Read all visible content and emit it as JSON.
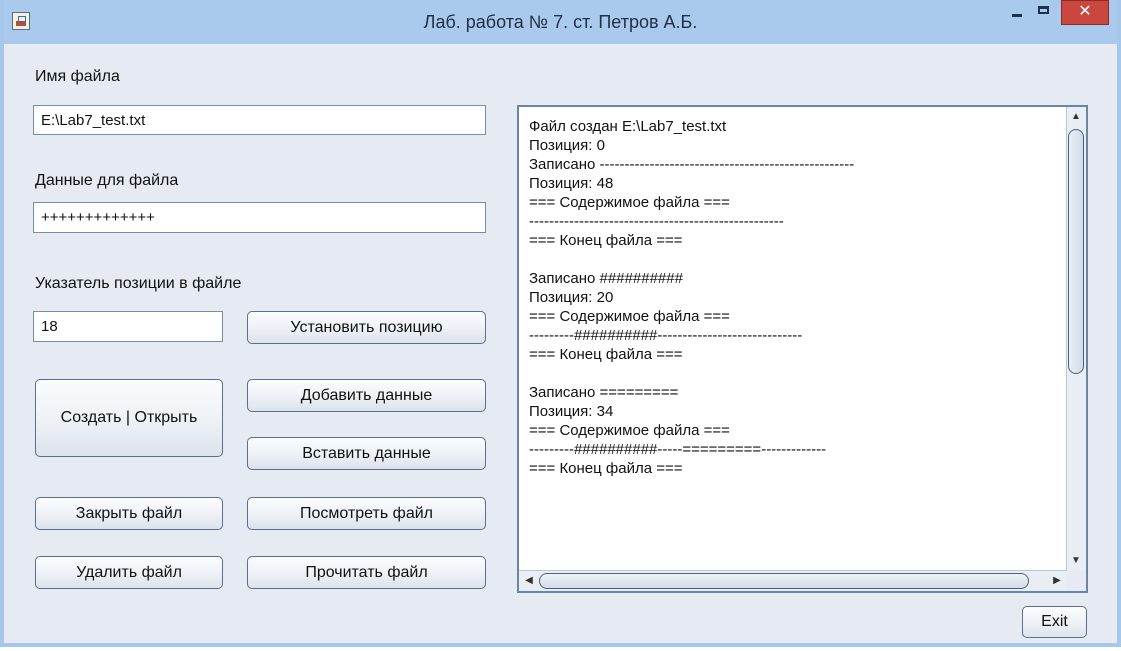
{
  "window": {
    "title": "Лаб. работа № 7. ст. Петров А.Б.",
    "close_symbol": "✕"
  },
  "form": {
    "filename_label": "Имя файла",
    "filename_value": "E:\\Lab7_test.txt",
    "data_label": "Данные для файла",
    "data_value": "+++++++++++++",
    "position_label": "Указатель позиции в файле",
    "position_value": "18"
  },
  "buttons": {
    "set_position": "Установить позицию",
    "create_open": "Создать | Открыть",
    "add_data": "Добавить данные",
    "insert_data": "Вставить данные",
    "close_file": "Закрыть файл",
    "view_file": "Посмотреть файл",
    "delete_file": "Удалить файл",
    "read_file": "Прочитать файл",
    "exit": "Exit"
  },
  "log": {
    "lines": [
      "Файл создан E:\\Lab7_test.txt",
      "Позиция: 0",
      "Записано ---------------------------------------------------",
      "Позиция: 48",
      "=== Содержимое файла ===",
      "---------------------------------------------------",
      "=== Конец файла ===",
      "",
      "Записано ##########",
      "Позиция: 20",
      "=== Содержимое файла ===",
      "---------##########-----------------------------",
      "=== Конец файла ===",
      "",
      "Записано =========",
      "Позиция: 34",
      "=== Содержимое файла ===",
      "---------##########-----=========-------------",
      "=== Конец файла ==="
    ]
  },
  "scrollbar": {
    "up_icon": "▲",
    "down_icon": "▼",
    "left_icon": "◀",
    "right_icon": "▶"
  }
}
